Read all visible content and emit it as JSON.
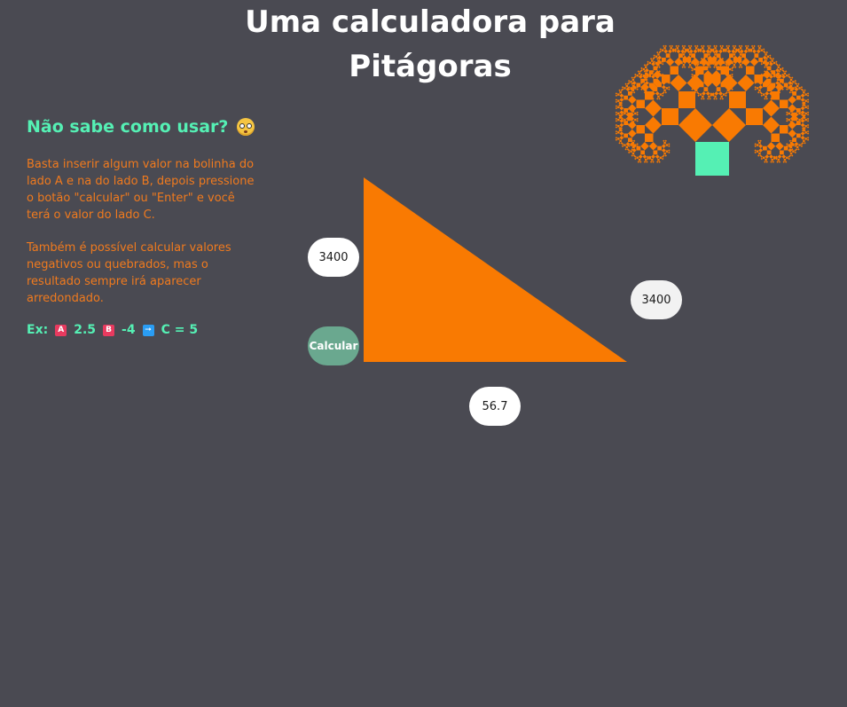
{
  "header": {
    "title_line1": "Uma calculadora para",
    "title_line2": "Pitágoras"
  },
  "help": {
    "title": "Não sabe como usar?",
    "emoji": "flushed-face-emoji",
    "paragraph1": "Basta inserir algum valor na bolinha do lado A e na do lado B, depois pressione o botão \"calcular\" ou \"Enter\" e você terá o valor do lado C.",
    "paragraph2": "Também é possível calcular valores negativos ou quebrados, mas o resultado sempre irá aparecer arredondado.",
    "example": {
      "prefix": "Ex:",
      "badge_a": "A",
      "value_a": "2.5",
      "badge_b": "B",
      "value_b": "-4",
      "arrow_icon": "right-arrow-icon",
      "result": "C = 5"
    }
  },
  "calculator": {
    "side_a_value": "3400",
    "side_b_value": "56.7",
    "side_c_value": "3400",
    "calculate_label": "Calcular"
  },
  "colors": {
    "background": "#4a4a52",
    "triangle": "#f97a02",
    "accent_green": "#55f0b4",
    "button": "#6aa88f",
    "text_orange": "#f07a1e"
  }
}
